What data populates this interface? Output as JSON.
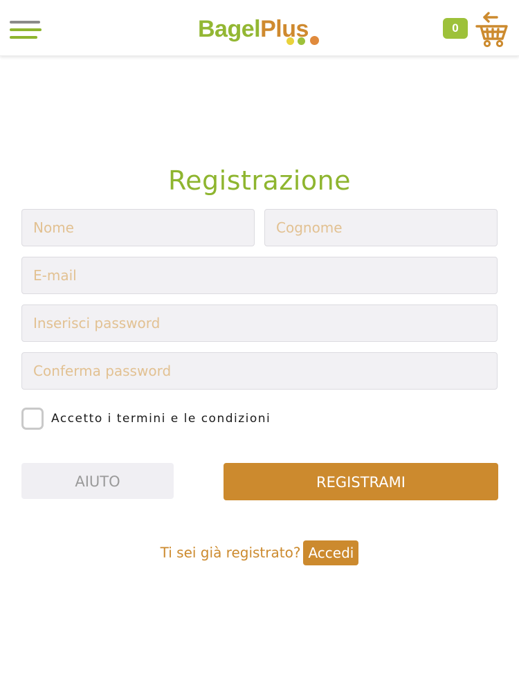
{
  "colors": {
    "green": "#8eb52f",
    "orange": "#cc8a2e",
    "menu_gray": "#8a8a8a",
    "logo_green": "#93b733",
    "logo_orange": "#cf8a2f",
    "dot_yellow": "#e9d23b",
    "dot_green": "#9dc13a",
    "dot_orange": "#e08a3c"
  },
  "header": {
    "menu_icon": "hamburger-icon",
    "logo": {
      "part1": "Bagel",
      "part2": "Plus"
    },
    "cart": {
      "count": "0",
      "icon": "shopping-cart-icon"
    }
  },
  "form": {
    "title": "Registrazione",
    "fields": {
      "first_name": {
        "value": "",
        "placeholder": "Nome"
      },
      "last_name": {
        "value": "",
        "placeholder": "Cognome"
      },
      "email": {
        "value": "",
        "placeholder": "E-mail"
      },
      "password": {
        "value": "",
        "placeholder": "Inserisci password"
      },
      "confirm_password": {
        "value": "",
        "placeholder": "Conferma password"
      }
    },
    "terms_label": "Accetto i termini e le condizioni",
    "terms_checked": false,
    "help_button": "AIUTO",
    "register_button": "REGISTRAMI"
  },
  "login": {
    "prompt": "Ti sei già registrato?",
    "link": "Accedi"
  }
}
